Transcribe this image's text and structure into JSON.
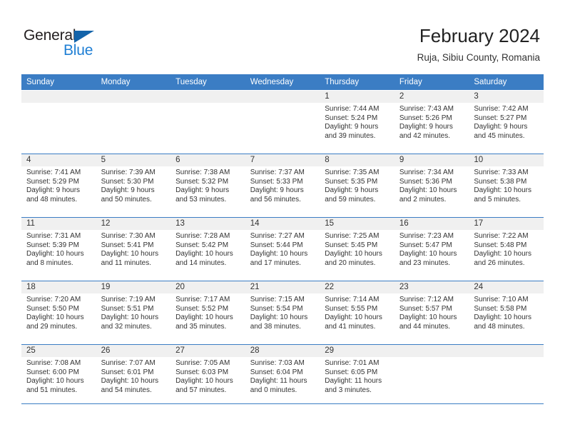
{
  "brand": {
    "name_top": "General",
    "name_bottom": "Blue",
    "accent_color": "#1f7fd4",
    "triangle_color": "#1464aa"
  },
  "header": {
    "title": "February 2024",
    "subtitle": "Ruja, Sibiu County, Romania"
  },
  "theme": {
    "header_bg": "#3b7dc4",
    "daynum_band_bg": "#f0f0f0",
    "grid_line": "#3b7dc4",
    "text": "#333333"
  },
  "weekday_headers": [
    "Sunday",
    "Monday",
    "Tuesday",
    "Wednesday",
    "Thursday",
    "Friday",
    "Saturday"
  ],
  "weeks": [
    [
      {
        "day": "",
        "blank": true,
        "sunrise": "",
        "sunset": "",
        "daylight_line1": "",
        "daylight_line2": ""
      },
      {
        "day": "",
        "blank": true,
        "sunrise": "",
        "sunset": "",
        "daylight_line1": "",
        "daylight_line2": ""
      },
      {
        "day": "",
        "blank": true,
        "sunrise": "",
        "sunset": "",
        "daylight_line1": "",
        "daylight_line2": ""
      },
      {
        "day": "",
        "blank": true,
        "sunrise": "",
        "sunset": "",
        "daylight_line1": "",
        "daylight_line2": ""
      },
      {
        "day": "1",
        "blank": false,
        "sunrise": "Sunrise: 7:44 AM",
        "sunset": "Sunset: 5:24 PM",
        "daylight_line1": "Daylight: 9 hours",
        "daylight_line2": "and 39 minutes."
      },
      {
        "day": "2",
        "blank": false,
        "sunrise": "Sunrise: 7:43 AM",
        "sunset": "Sunset: 5:26 PM",
        "daylight_line1": "Daylight: 9 hours",
        "daylight_line2": "and 42 minutes."
      },
      {
        "day": "3",
        "blank": false,
        "sunrise": "Sunrise: 7:42 AM",
        "sunset": "Sunset: 5:27 PM",
        "daylight_line1": "Daylight: 9 hours",
        "daylight_line2": "and 45 minutes."
      }
    ],
    [
      {
        "day": "4",
        "blank": false,
        "sunrise": "Sunrise: 7:41 AM",
        "sunset": "Sunset: 5:29 PM",
        "daylight_line1": "Daylight: 9 hours",
        "daylight_line2": "and 48 minutes."
      },
      {
        "day": "5",
        "blank": false,
        "sunrise": "Sunrise: 7:39 AM",
        "sunset": "Sunset: 5:30 PM",
        "daylight_line1": "Daylight: 9 hours",
        "daylight_line2": "and 50 minutes."
      },
      {
        "day": "6",
        "blank": false,
        "sunrise": "Sunrise: 7:38 AM",
        "sunset": "Sunset: 5:32 PM",
        "daylight_line1": "Daylight: 9 hours",
        "daylight_line2": "and 53 minutes."
      },
      {
        "day": "7",
        "blank": false,
        "sunrise": "Sunrise: 7:37 AM",
        "sunset": "Sunset: 5:33 PM",
        "daylight_line1": "Daylight: 9 hours",
        "daylight_line2": "and 56 minutes."
      },
      {
        "day": "8",
        "blank": false,
        "sunrise": "Sunrise: 7:35 AM",
        "sunset": "Sunset: 5:35 PM",
        "daylight_line1": "Daylight: 9 hours",
        "daylight_line2": "and 59 minutes."
      },
      {
        "day": "9",
        "blank": false,
        "sunrise": "Sunrise: 7:34 AM",
        "sunset": "Sunset: 5:36 PM",
        "daylight_line1": "Daylight: 10 hours",
        "daylight_line2": "and 2 minutes."
      },
      {
        "day": "10",
        "blank": false,
        "sunrise": "Sunrise: 7:33 AM",
        "sunset": "Sunset: 5:38 PM",
        "daylight_line1": "Daylight: 10 hours",
        "daylight_line2": "and 5 minutes."
      }
    ],
    [
      {
        "day": "11",
        "blank": false,
        "sunrise": "Sunrise: 7:31 AM",
        "sunset": "Sunset: 5:39 PM",
        "daylight_line1": "Daylight: 10 hours",
        "daylight_line2": "and 8 minutes."
      },
      {
        "day": "12",
        "blank": false,
        "sunrise": "Sunrise: 7:30 AM",
        "sunset": "Sunset: 5:41 PM",
        "daylight_line1": "Daylight: 10 hours",
        "daylight_line2": "and 11 minutes."
      },
      {
        "day": "13",
        "blank": false,
        "sunrise": "Sunrise: 7:28 AM",
        "sunset": "Sunset: 5:42 PM",
        "daylight_line1": "Daylight: 10 hours",
        "daylight_line2": "and 14 minutes."
      },
      {
        "day": "14",
        "blank": false,
        "sunrise": "Sunrise: 7:27 AM",
        "sunset": "Sunset: 5:44 PM",
        "daylight_line1": "Daylight: 10 hours",
        "daylight_line2": "and 17 minutes."
      },
      {
        "day": "15",
        "blank": false,
        "sunrise": "Sunrise: 7:25 AM",
        "sunset": "Sunset: 5:45 PM",
        "daylight_line1": "Daylight: 10 hours",
        "daylight_line2": "and 20 minutes."
      },
      {
        "day": "16",
        "blank": false,
        "sunrise": "Sunrise: 7:23 AM",
        "sunset": "Sunset: 5:47 PM",
        "daylight_line1": "Daylight: 10 hours",
        "daylight_line2": "and 23 minutes."
      },
      {
        "day": "17",
        "blank": false,
        "sunrise": "Sunrise: 7:22 AM",
        "sunset": "Sunset: 5:48 PM",
        "daylight_line1": "Daylight: 10 hours",
        "daylight_line2": "and 26 minutes."
      }
    ],
    [
      {
        "day": "18",
        "blank": false,
        "sunrise": "Sunrise: 7:20 AM",
        "sunset": "Sunset: 5:50 PM",
        "daylight_line1": "Daylight: 10 hours",
        "daylight_line2": "and 29 minutes."
      },
      {
        "day": "19",
        "blank": false,
        "sunrise": "Sunrise: 7:19 AM",
        "sunset": "Sunset: 5:51 PM",
        "daylight_line1": "Daylight: 10 hours",
        "daylight_line2": "and 32 minutes."
      },
      {
        "day": "20",
        "blank": false,
        "sunrise": "Sunrise: 7:17 AM",
        "sunset": "Sunset: 5:52 PM",
        "daylight_line1": "Daylight: 10 hours",
        "daylight_line2": "and 35 minutes."
      },
      {
        "day": "21",
        "blank": false,
        "sunrise": "Sunrise: 7:15 AM",
        "sunset": "Sunset: 5:54 PM",
        "daylight_line1": "Daylight: 10 hours",
        "daylight_line2": "and 38 minutes."
      },
      {
        "day": "22",
        "blank": false,
        "sunrise": "Sunrise: 7:14 AM",
        "sunset": "Sunset: 5:55 PM",
        "daylight_line1": "Daylight: 10 hours",
        "daylight_line2": "and 41 minutes."
      },
      {
        "day": "23",
        "blank": false,
        "sunrise": "Sunrise: 7:12 AM",
        "sunset": "Sunset: 5:57 PM",
        "daylight_line1": "Daylight: 10 hours",
        "daylight_line2": "and 44 minutes."
      },
      {
        "day": "24",
        "blank": false,
        "sunrise": "Sunrise: 7:10 AM",
        "sunset": "Sunset: 5:58 PM",
        "daylight_line1": "Daylight: 10 hours",
        "daylight_line2": "and 48 minutes."
      }
    ],
    [
      {
        "day": "25",
        "blank": false,
        "sunrise": "Sunrise: 7:08 AM",
        "sunset": "Sunset: 6:00 PM",
        "daylight_line1": "Daylight: 10 hours",
        "daylight_line2": "and 51 minutes."
      },
      {
        "day": "26",
        "blank": false,
        "sunrise": "Sunrise: 7:07 AM",
        "sunset": "Sunset: 6:01 PM",
        "daylight_line1": "Daylight: 10 hours",
        "daylight_line2": "and 54 minutes."
      },
      {
        "day": "27",
        "blank": false,
        "sunrise": "Sunrise: 7:05 AM",
        "sunset": "Sunset: 6:03 PM",
        "daylight_line1": "Daylight: 10 hours",
        "daylight_line2": "and 57 minutes."
      },
      {
        "day": "28",
        "blank": false,
        "sunrise": "Sunrise: 7:03 AM",
        "sunset": "Sunset: 6:04 PM",
        "daylight_line1": "Daylight: 11 hours",
        "daylight_line2": "and 0 minutes."
      },
      {
        "day": "29",
        "blank": false,
        "sunrise": "Sunrise: 7:01 AM",
        "sunset": "Sunset: 6:05 PM",
        "daylight_line1": "Daylight: 11 hours",
        "daylight_line2": "and 3 minutes."
      },
      {
        "day": "",
        "blank": true,
        "sunrise": "",
        "sunset": "",
        "daylight_line1": "",
        "daylight_line2": ""
      },
      {
        "day": "",
        "blank": true,
        "sunrise": "",
        "sunset": "",
        "daylight_line1": "",
        "daylight_line2": ""
      }
    ]
  ]
}
